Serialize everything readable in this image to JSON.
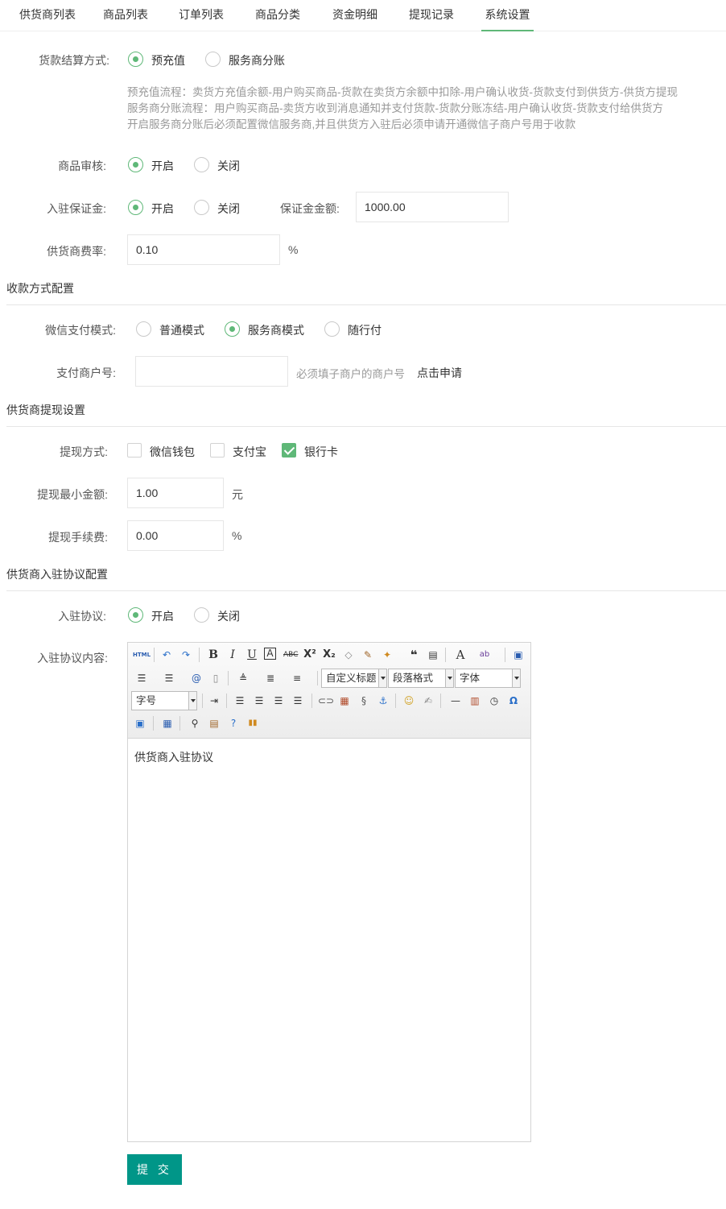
{
  "tabs": [
    "供货商列表",
    "商品列表",
    "订单列表",
    "商品分类",
    "资金明细",
    "提现记录",
    "系统设置"
  ],
  "settlement": {
    "label": "货款结算方式:",
    "options": [
      "预充值",
      "服务商分账"
    ],
    "notes": [
      "预充值流程：卖货方充值余额-用户购买商品-货款在卖货方余额中扣除-用户确认收货-货款支付到供货方-供货方提现",
      "服务商分账流程：用户购买商品-卖货方收到消息通知并支付货款-货款分账冻结-用户确认收货-货款支付给供货方",
      "开启服务商分账后必须配置微信服务商,并且供货方入驻后必须申请开通微信子商户号用于收款"
    ]
  },
  "audit": {
    "label": "商品审核:",
    "options": [
      "开启",
      "关闭"
    ]
  },
  "deposit": {
    "label": "入驻保证金:",
    "options": [
      "开启",
      "关闭"
    ],
    "amount_label": "保证金金额:",
    "amount": "1000.00"
  },
  "fee": {
    "label": "供货商费率:",
    "value": "0.10",
    "unit": "%"
  },
  "payment_section": "收款方式配置",
  "wechat_mode": {
    "label": "微信支付模式:",
    "options": [
      "普通模式",
      "服务商模式",
      "随行付"
    ]
  },
  "merchant": {
    "label": "支付商户号:",
    "value": "",
    "hint": "必须填子商户的商户号",
    "apply": "点击申请"
  },
  "withdraw_section": "供货商提现设置",
  "withdraw_method": {
    "label": "提现方式:",
    "options": [
      "微信钱包",
      "支付宝",
      "银行卡"
    ]
  },
  "withdraw_min": {
    "label": "提现最小金额:",
    "value": "1.00",
    "unit": "元"
  },
  "withdraw_fee": {
    "label": "提现手续费:",
    "value": "0.00",
    "unit": "%"
  },
  "agreement_section": "供货商入驻协议配置",
  "agreement": {
    "label": "入驻协议:",
    "options": [
      "开启",
      "关闭"
    ]
  },
  "agreement_content": {
    "label": "入驻协议内容:",
    "text": "供货商入驻协议",
    "html_btn": "HTML",
    "sel_heading": "自定义标题",
    "sel_paragraph": "段落格式",
    "sel_font": "字体",
    "sel_size": "字号"
  },
  "submit": "提 交",
  "colors": {
    "accent": "#5fb878",
    "button": "#009688"
  }
}
